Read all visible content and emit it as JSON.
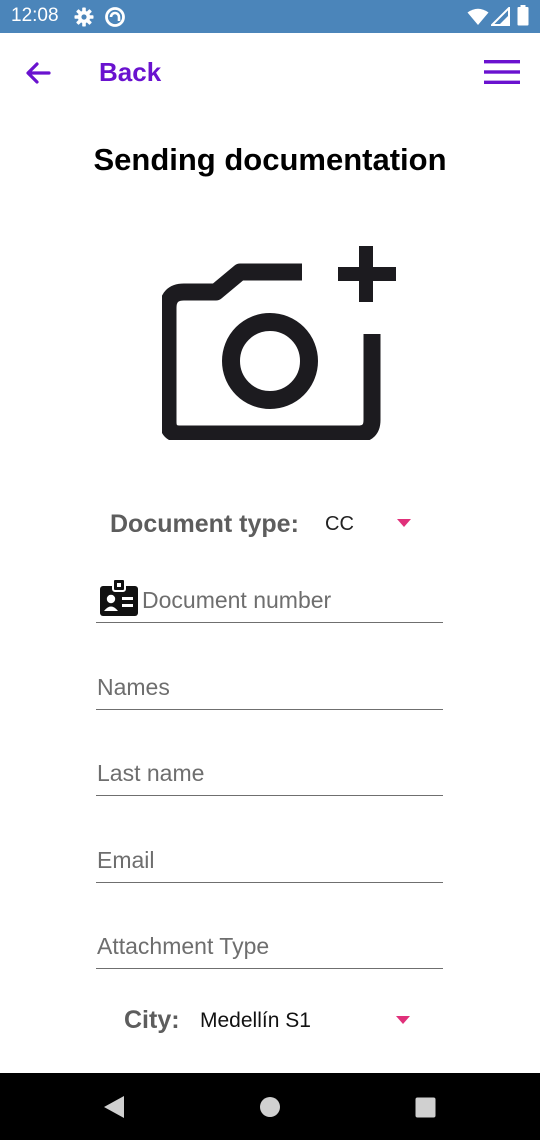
{
  "status_bar": {
    "time": "12:08",
    "icons": [
      "gear-icon",
      "sync-icon",
      "wifi-icon",
      "signal-icon",
      "battery-icon"
    ],
    "background": "#4b85ba"
  },
  "app_bar": {
    "back_label": "Back",
    "accent_color": "#6a12cf"
  },
  "page": {
    "title": "Sending documentation",
    "camera_icon": "add-photo-icon"
  },
  "form": {
    "document_type": {
      "label": "Document type:",
      "value": "CC"
    },
    "document_number": {
      "placeholder": "Document number",
      "icon": "id-badge-icon"
    },
    "names": {
      "placeholder": "Names"
    },
    "last_name": {
      "placeholder": "Last name"
    },
    "email": {
      "placeholder": "Email"
    },
    "attachment_type": {
      "placeholder": "Attachment Type"
    },
    "city": {
      "label": "City:",
      "value": "Medellín S1"
    },
    "dropdown_caret_color": "#e0307a"
  },
  "nav_bar": {
    "icons": [
      "nav-back-icon",
      "nav-home-icon",
      "nav-recents-icon"
    ]
  }
}
